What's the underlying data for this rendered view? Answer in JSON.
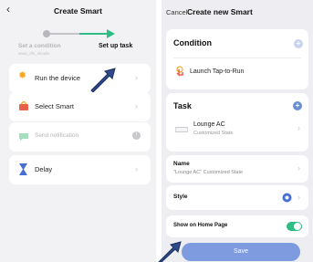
{
  "left": {
    "back_icon": "chevron-left-icon",
    "title": "Create Smart",
    "steps": {
      "step1_label": "Set a condition",
      "step1_sub": "www_dhi_vtcode",
      "step2_label": "Set up task"
    },
    "items": [
      {
        "label": "Run the device",
        "icon": "sun-icon",
        "icon_color": "#f5a623"
      },
      {
        "label": "Select Smart",
        "icon": "smart-icon",
        "icon_color": "#e8604c"
      },
      {
        "label": "Send notification",
        "icon": "notification-icon",
        "icon_color": "#7fd3a3"
      },
      {
        "label": "Delay",
        "icon": "hourglass-icon",
        "icon_color": "#4a6fd3"
      }
    ],
    "pointer_icon": "arrow-pointer-icon"
  },
  "right": {
    "cancel": "Cancel",
    "title": "Create new Smart",
    "condition": {
      "heading": "Condition",
      "item_label": "Launch Tap-to-Run",
      "item_icon": "tap-icon"
    },
    "task": {
      "heading": "Task",
      "item_label": "Lounge AC",
      "item_sub": "Customized State",
      "item_icon": "ac-device-icon"
    },
    "name": {
      "label": "Name",
      "value": "\"Lounge AC\" Customized State"
    },
    "style": {
      "label": "Style",
      "icon": "style-swatch-icon"
    },
    "show_home": {
      "label": "Show on Home Page",
      "on": true
    },
    "save": "Save",
    "pointer_icon": "arrow-pointer-icon"
  },
  "colors": {
    "accent": "#2ebd85",
    "blue": "#6b8fd6",
    "save_button": "#7e9be0",
    "toggle_on": "#2ebd85"
  }
}
